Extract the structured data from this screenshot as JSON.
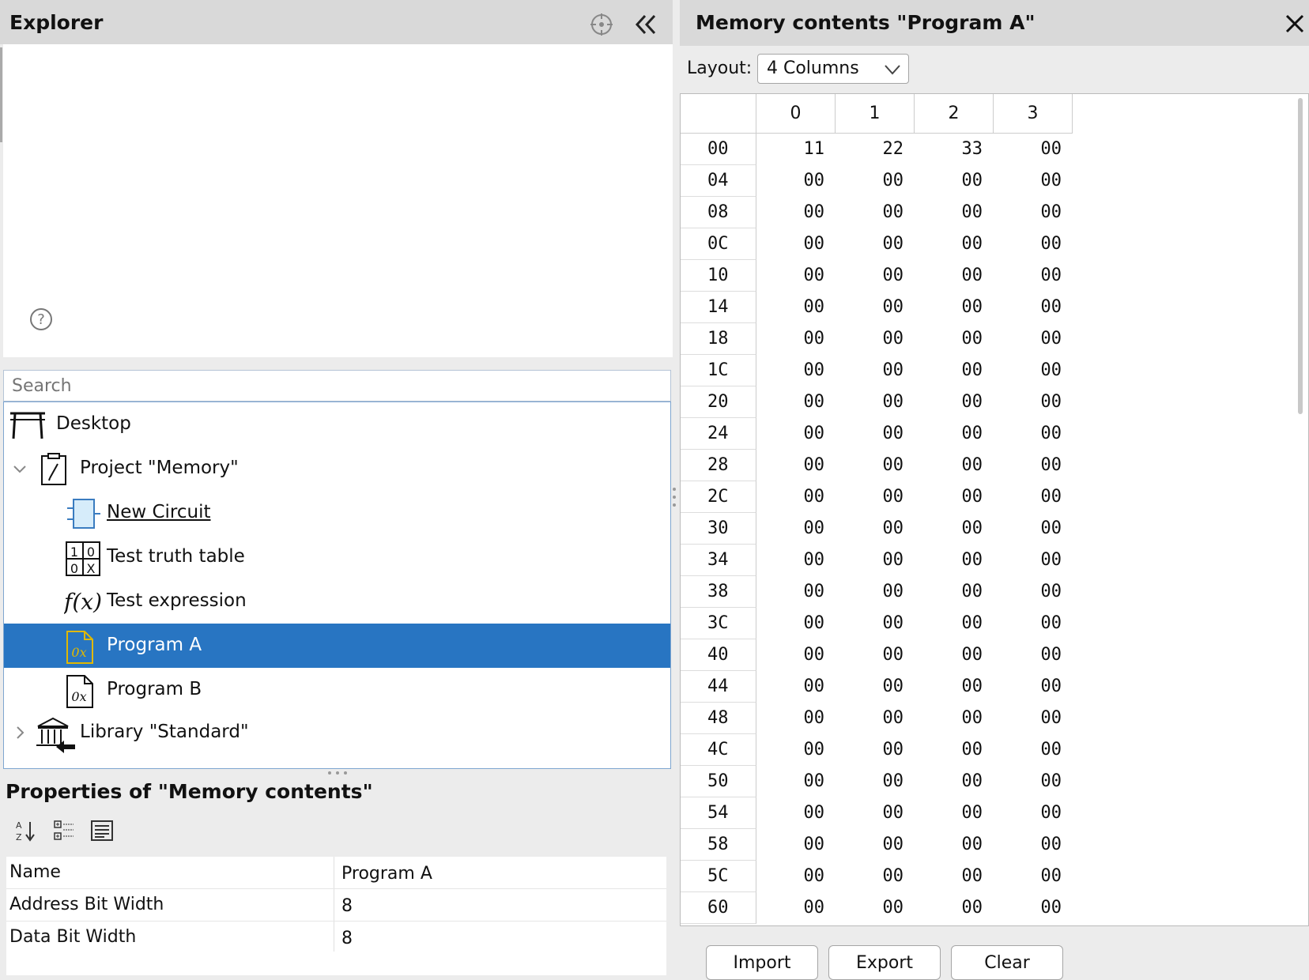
{
  "explorer": {
    "title": "Explorer",
    "search_placeholder": "Search",
    "tree": [
      {
        "label": "Desktop",
        "icon": "desk-icon"
      },
      {
        "label": "Project \"Memory\"",
        "icon": "project-icon",
        "expanded": true
      },
      {
        "label": "New Circuit",
        "icon": "circuit-icon"
      },
      {
        "label": "Test truth table",
        "icon": "truth-table-icon"
      },
      {
        "label": "Test expression",
        "icon": "expression-icon"
      },
      {
        "label": "Program A",
        "icon": "memory-file-icon",
        "selected": true
      },
      {
        "label": "Program B",
        "icon": "memory-file-icon"
      },
      {
        "label": "Library \"Standard\"",
        "icon": "library-icon",
        "expanded": false
      }
    ]
  },
  "properties": {
    "title": "Properties of \"Memory contents\"",
    "rows": [
      {
        "key": "Name",
        "value": "Program A"
      },
      {
        "key": "Address Bit Width",
        "value": "8"
      },
      {
        "key": "Data Bit Width",
        "value": "8"
      }
    ]
  },
  "memory": {
    "title": "Memory contents \"Program A\"",
    "layout_label": "Layout:",
    "layout_value": "4 Columns",
    "columns": [
      "0",
      "1",
      "2",
      "3"
    ],
    "rows": [
      {
        "addr": "00",
        "values": [
          "11",
          "22",
          "33",
          "00"
        ]
      },
      {
        "addr": "04",
        "values": [
          "00",
          "00",
          "00",
          "00"
        ]
      },
      {
        "addr": "08",
        "values": [
          "00",
          "00",
          "00",
          "00"
        ]
      },
      {
        "addr": "0C",
        "values": [
          "00",
          "00",
          "00",
          "00"
        ]
      },
      {
        "addr": "10",
        "values": [
          "00",
          "00",
          "00",
          "00"
        ]
      },
      {
        "addr": "14",
        "values": [
          "00",
          "00",
          "00",
          "00"
        ]
      },
      {
        "addr": "18",
        "values": [
          "00",
          "00",
          "00",
          "00"
        ]
      },
      {
        "addr": "1C",
        "values": [
          "00",
          "00",
          "00",
          "00"
        ]
      },
      {
        "addr": "20",
        "values": [
          "00",
          "00",
          "00",
          "00"
        ]
      },
      {
        "addr": "24",
        "values": [
          "00",
          "00",
          "00",
          "00"
        ]
      },
      {
        "addr": "28",
        "values": [
          "00",
          "00",
          "00",
          "00"
        ]
      },
      {
        "addr": "2C",
        "values": [
          "00",
          "00",
          "00",
          "00"
        ]
      },
      {
        "addr": "30",
        "values": [
          "00",
          "00",
          "00",
          "00"
        ]
      },
      {
        "addr": "34",
        "values": [
          "00",
          "00",
          "00",
          "00"
        ]
      },
      {
        "addr": "38",
        "values": [
          "00",
          "00",
          "00",
          "00"
        ]
      },
      {
        "addr": "3C",
        "values": [
          "00",
          "00",
          "00",
          "00"
        ]
      },
      {
        "addr": "40",
        "values": [
          "00",
          "00",
          "00",
          "00"
        ]
      },
      {
        "addr": "44",
        "values": [
          "00",
          "00",
          "00",
          "00"
        ]
      },
      {
        "addr": "48",
        "values": [
          "00",
          "00",
          "00",
          "00"
        ]
      },
      {
        "addr": "4C",
        "values": [
          "00",
          "00",
          "00",
          "00"
        ]
      },
      {
        "addr": "50",
        "values": [
          "00",
          "00",
          "00",
          "00"
        ]
      },
      {
        "addr": "54",
        "values": [
          "00",
          "00",
          "00",
          "00"
        ]
      },
      {
        "addr": "58",
        "values": [
          "00",
          "00",
          "00",
          "00"
        ]
      },
      {
        "addr": "5C",
        "values": [
          "00",
          "00",
          "00",
          "00"
        ]
      },
      {
        "addr": "60",
        "values": [
          "00",
          "00",
          "00",
          "00"
        ]
      }
    ],
    "buttons": {
      "import": "Import",
      "export": "Export",
      "clear": "Clear"
    }
  },
  "colors": {
    "selection": "#2875c2",
    "header": "#d9d9d9",
    "memory_icon_accent": "#e0b800"
  }
}
